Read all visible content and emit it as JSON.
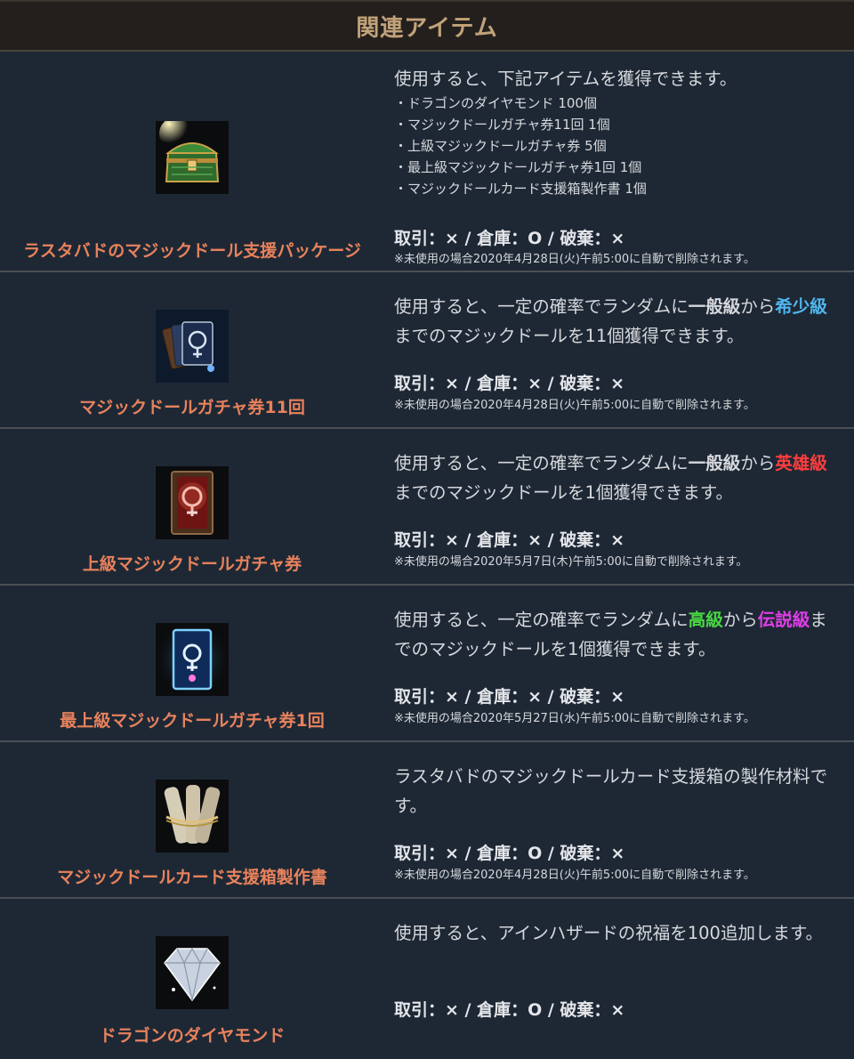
{
  "header": {
    "title": "関連アイテム"
  },
  "items": [
    {
      "name": "ラスタバドのマジックドール支援パッケージ",
      "desc": "使用すると、下記アイテムを獲得できます。",
      "list": [
        "・ドラゴンのダイヤモンド 100個",
        "・マジックドールガチャ券11回 1個",
        "・上級マジックドールガチャ券 5個",
        "・最上級マジックドールガチャ券1回 1個",
        "・マジックドールカード支援箱製作書 1個"
      ],
      "trade": "取引：× / 倉庫：O / 破棄：×",
      "note": "※未使用の場合2020年4月28日(火)午前5:00に自動で削除されます。"
    },
    {
      "name": "マジックドールガチャ券11回",
      "desc_parts": {
        "a": "使用すると、一定の確率でランダムに",
        "b": "一般級",
        "c": "から",
        "d": "希少級",
        "e": "までのマジックドールを11個獲得できます。"
      },
      "trade": "取引：× / 倉庫：× / 破棄：×",
      "note": "※未使用の場合2020年4月28日(火)午前5:00に自動で削除されます。"
    },
    {
      "name": "上級マジックドールガチャ券",
      "desc_parts": {
        "a": "使用すると、一定の確率でランダムに",
        "b": "一般級",
        "c": "から",
        "d": "英雄級",
        "e": "までのマジックドールを1個獲得できます。"
      },
      "trade": "取引：× / 倉庫：× / 破棄：×",
      "note": "※未使用の場合2020年5月7日(木)午前5:00に自動で削除されます。"
    },
    {
      "name": "最上級マジックドールガチャ券1回",
      "desc_parts": {
        "a": "使用すると、一定の確率でランダムに",
        "b": "高級",
        "c": "から",
        "d": "伝説級",
        "e": "までのマジックドールを1個獲得できます。"
      },
      "trade": "取引：× / 倉庫：× / 破棄：×",
      "note": "※未使用の場合2020年5月27日(水)午前5:00に自動で削除されます。"
    },
    {
      "name": "マジックドールカード支援箱製作書",
      "desc": "ラスタバドのマジックドールカード支援箱の製作材料です。",
      "trade": "取引：× / 倉庫：O / 破棄：×",
      "note": "※未使用の場合2020年4月28日(火)午前5:00に自動で削除されます。"
    },
    {
      "name": "ドラゴンのダイヤモンド",
      "desc": "使用すると、アインハザードの祝福を100追加します。",
      "trade": "取引：× / 倉庫：O / 破棄：×"
    }
  ],
  "colors": {
    "name": "#e8825c",
    "header_text": "#c2a27a",
    "rare": "#4fb6ee",
    "hero": "#ff3e3e",
    "high": "#49d642",
    "legend": "#e03ee8"
  }
}
